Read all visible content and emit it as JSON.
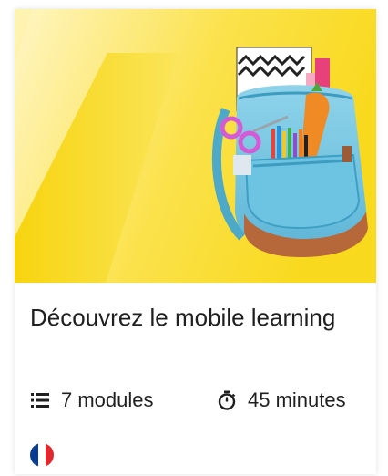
{
  "card": {
    "title": "Découvrez le mobile learning",
    "hero_image": "backpack-with-school-supplies",
    "modules_icon": "list-icon",
    "modules_text": "7 modules",
    "duration_icon": "stopwatch-icon",
    "duration_text": "45 minutes",
    "language_flag": "french-flag-icon",
    "flag_colors": [
      "#0a3d91",
      "#ffffff",
      "#e2272e"
    ]
  },
  "colors": {
    "hero_yellow": "#fbe04a",
    "text": "#1f1f1f"
  }
}
